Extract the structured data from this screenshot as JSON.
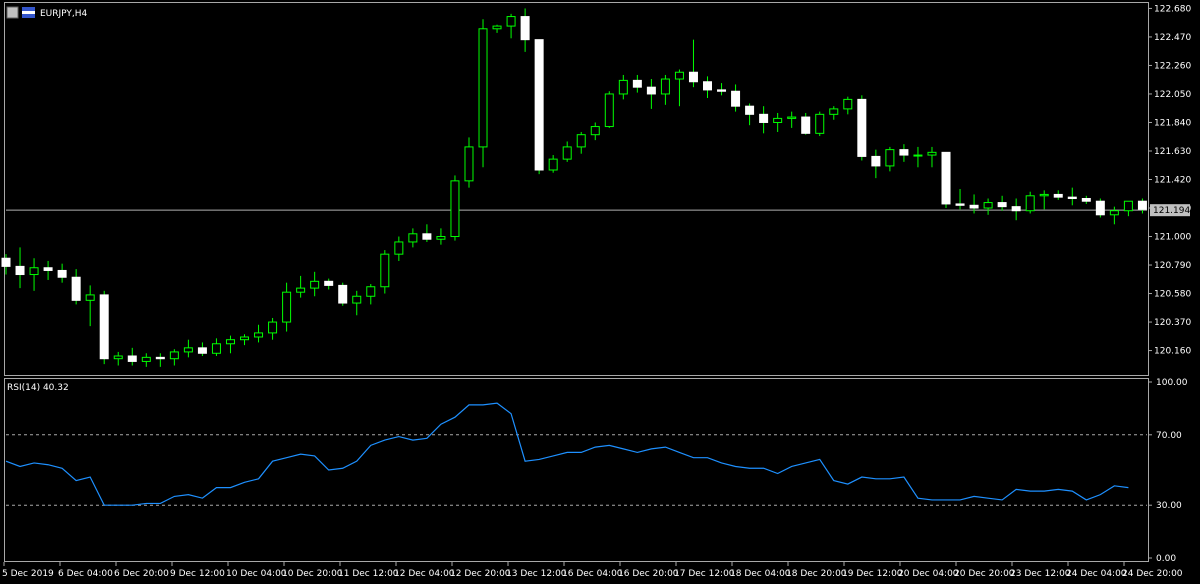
{
  "chart_data": [
    {
      "type": "candlestick",
      "symbol_label": "EURJPY,H4",
      "ylim": [
        119.98,
        122.72
      ],
      "y_ticks": [
        "122.680",
        "122.470",
        "122.260",
        "122.050",
        "121.840",
        "121.630",
        "121.420",
        "121.210",
        "121.000",
        "120.790",
        "120.580",
        "120.370",
        "120.160"
      ],
      "current_price": 121.194,
      "current_price_label": "121.194",
      "bull_color": "#00ff00",
      "bear_color": "#ffffff",
      "background": "#000000",
      "x_labels": [
        "5 Dec 2019",
        "6 Dec 04:00",
        "6 Dec 20:00",
        "9 Dec 12:00",
        "10 Dec 04:00",
        "10 Dec 20:00",
        "11 Dec 12:00",
        "12 Dec 04:00",
        "12 Dec 20:00",
        "13 Dec 12:00",
        "16 Dec 04:00",
        "16 Dec 20:00",
        "17 Dec 12:00",
        "18 Dec 04:00",
        "18 Dec 20:00",
        "19 Dec 12:00",
        "20 Dec 04:00",
        "20 Dec 20:00",
        "23 Dec 12:00",
        "24 Dec 04:00",
        "24 Dec 20:00"
      ],
      "candles": [
        [
          120.84,
          120.87,
          120.72,
          120.78
        ],
        [
          120.78,
          120.92,
          120.62,
          120.72
        ],
        [
          120.72,
          120.84,
          120.6,
          120.77
        ],
        [
          120.77,
          120.82,
          120.68,
          120.75
        ],
        [
          120.75,
          120.8,
          120.66,
          120.7
        ],
        [
          120.7,
          120.76,
          120.5,
          120.53
        ],
        [
          120.53,
          120.64,
          120.34,
          120.57
        ],
        [
          120.57,
          120.6,
          120.06,
          120.1
        ],
        [
          120.1,
          120.15,
          120.05,
          120.12
        ],
        [
          120.12,
          120.18,
          120.05,
          120.08
        ],
        [
          120.08,
          120.14,
          120.04,
          120.11
        ],
        [
          120.11,
          120.14,
          120.04,
          120.1
        ],
        [
          120.1,
          120.17,
          120.05,
          120.15
        ],
        [
          120.15,
          120.24,
          120.11,
          120.18
        ],
        [
          120.18,
          120.22,
          120.12,
          120.14
        ],
        [
          120.14,
          120.25,
          120.12,
          120.21
        ],
        [
          120.21,
          120.27,
          120.14,
          120.24
        ],
        [
          120.24,
          120.28,
          120.2,
          120.26
        ],
        [
          120.26,
          120.35,
          120.22,
          120.29
        ],
        [
          120.29,
          120.4,
          120.24,
          120.37
        ],
        [
          120.37,
          120.66,
          120.3,
          120.59
        ],
        [
          120.59,
          120.71,
          120.55,
          120.62
        ],
        [
          120.62,
          120.74,
          120.56,
          120.67
        ],
        [
          120.67,
          120.69,
          120.61,
          120.64
        ],
        [
          120.64,
          120.66,
          120.49,
          120.51
        ],
        [
          120.51,
          120.6,
          120.42,
          120.56
        ],
        [
          120.56,
          120.65,
          120.5,
          120.63
        ],
        [
          120.63,
          120.9,
          120.58,
          120.87
        ],
        [
          120.87,
          121.0,
          120.82,
          120.96
        ],
        [
          120.96,
          121.06,
          120.92,
          121.02
        ],
        [
          121.02,
          121.09,
          120.96,
          120.98
        ],
        [
          120.98,
          121.06,
          120.94,
          121.0
        ],
        [
          121.0,
          121.45,
          120.97,
          121.41
        ],
        [
          121.41,
          121.73,
          121.36,
          121.66
        ],
        [
          121.66,
          122.6,
          121.51,
          122.53
        ],
        [
          122.53,
          122.56,
          122.5,
          122.55
        ],
        [
          122.55,
          122.64,
          122.46,
          122.62
        ],
        [
          122.62,
          122.68,
          122.36,
          122.45
        ],
        [
          122.45,
          122.45,
          121.46,
          121.49
        ],
        [
          121.49,
          121.6,
          121.47,
          121.57
        ],
        [
          121.57,
          121.7,
          121.55,
          121.66
        ],
        [
          121.66,
          121.77,
          121.61,
          121.75
        ],
        [
          121.75,
          121.84,
          121.71,
          121.81
        ],
        [
          121.81,
          122.07,
          121.8,
          122.05
        ],
        [
          122.05,
          122.19,
          122.01,
          122.15
        ],
        [
          122.15,
          122.19,
          122.06,
          122.1
        ],
        [
          122.1,
          122.16,
          121.94,
          122.05
        ],
        [
          122.05,
          122.19,
          121.97,
          122.16
        ],
        [
          122.16,
          122.23,
          121.96,
          122.21
        ],
        [
          122.21,
          122.45,
          122.1,
          122.14
        ],
        [
          122.14,
          122.18,
          122.02,
          122.08
        ],
        [
          122.08,
          122.13,
          122.04,
          122.07
        ],
        [
          122.07,
          122.12,
          121.92,
          121.96
        ],
        [
          121.96,
          121.98,
          121.82,
          121.9
        ],
        [
          121.9,
          121.96,
          121.76,
          121.84
        ],
        [
          121.84,
          121.91,
          121.77,
          121.87
        ],
        [
          121.87,
          121.92,
          121.8,
          121.88
        ],
        [
          121.88,
          121.91,
          121.75,
          121.76
        ],
        [
          121.76,
          121.92,
          121.74,
          121.9
        ],
        [
          121.9,
          121.96,
          121.86,
          121.94
        ],
        [
          121.94,
          122.03,
          121.9,
          122.01
        ],
        [
          122.01,
          122.04,
          121.56,
          121.59
        ],
        [
          121.59,
          121.64,
          121.43,
          121.52
        ],
        [
          121.52,
          121.66,
          121.48,
          121.64
        ],
        [
          121.64,
          121.68,
          121.55,
          121.6
        ],
        [
          121.6,
          121.66,
          121.51,
          121.6
        ],
        [
          121.6,
          121.66,
          121.51,
          121.62
        ],
        [
          121.62,
          121.62,
          121.21,
          121.24
        ],
        [
          121.24,
          121.35,
          121.2,
          121.23
        ],
        [
          121.23,
          121.31,
          121.17,
          121.21
        ],
        [
          121.21,
          121.28,
          121.16,
          121.25
        ],
        [
          121.25,
          121.3,
          121.19,
          121.22
        ],
        [
          121.22,
          121.28,
          121.12,
          121.19
        ],
        [
          121.19,
          121.33,
          121.17,
          121.3
        ],
        [
          121.3,
          121.34,
          121.2,
          121.31
        ],
        [
          121.31,
          121.34,
          121.27,
          121.29
        ],
        [
          121.29,
          121.36,
          121.23,
          121.28
        ],
        [
          121.28,
          121.3,
          121.24,
          121.26
        ],
        [
          121.26,
          121.28,
          121.14,
          121.16
        ],
        [
          121.16,
          121.22,
          121.09,
          121.19
        ],
        [
          121.19,
          121.26,
          121.15,
          121.26
        ],
        [
          121.26,
          121.28,
          121.17,
          121.2
        ]
      ]
    },
    {
      "type": "line",
      "indicator_label": "RSI(14) 40.32",
      "ylim": [
        0,
        100
      ],
      "y_ticks": [
        "100.00",
        "70.00",
        "30.00",
        "0.00"
      ],
      "levels": [
        70,
        30
      ],
      "line_color": "#1e90ff",
      "values": [
        55,
        52,
        54,
        53,
        51,
        44,
        46,
        30,
        30,
        30,
        31,
        31,
        35,
        36,
        34,
        40,
        40,
        43,
        45,
        55,
        57,
        59,
        58,
        50,
        51,
        55,
        64,
        67,
        69,
        67,
        68,
        76,
        80,
        87,
        87,
        88,
        82,
        55,
        56,
        58,
        60,
        60,
        63,
        64,
        62,
        60,
        62,
        63,
        60,
        57,
        57,
        54,
        52,
        51,
        51,
        48,
        52,
        54,
        56,
        44,
        42,
        46,
        45,
        45,
        46,
        34,
        33,
        33,
        33,
        35,
        34,
        33,
        39,
        38,
        38,
        39,
        38,
        33,
        36,
        41,
        40
      ]
    }
  ]
}
